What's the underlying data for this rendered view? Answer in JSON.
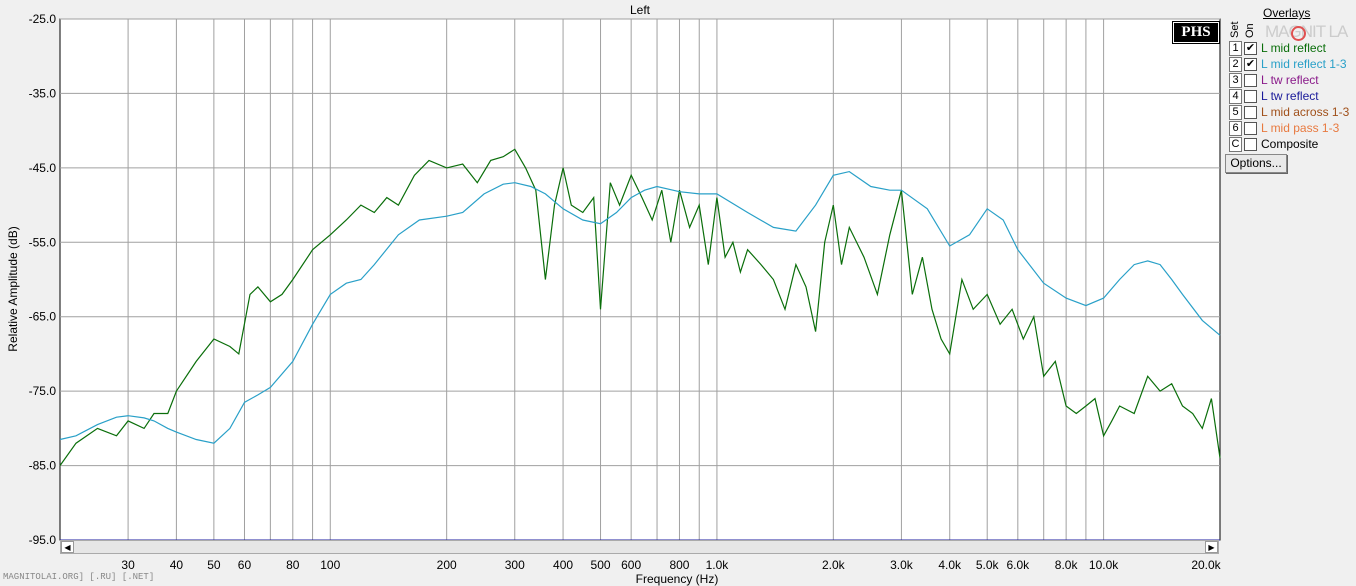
{
  "chart_data": {
    "type": "line",
    "title": "Left",
    "xlabel": "Frequency (Hz)",
    "ylabel": "Relative Amplitude (dB)",
    "xscale": "log",
    "xlim": [
      20,
      20000
    ],
    "ylim": [
      -95,
      -25
    ],
    "grid": true,
    "yticks": [
      "-25.0",
      "-35.0",
      "-45.0",
      "-55.0",
      "-65.0",
      "-75.0",
      "-85.0",
      "-95.0"
    ],
    "xticks": [
      {
        "v": 30,
        "label": "30"
      },
      {
        "v": 40,
        "label": "40"
      },
      {
        "v": 50,
        "label": "50"
      },
      {
        "v": 60,
        "label": "60"
      },
      {
        "v": 80,
        "label": "80"
      },
      {
        "v": 100,
        "label": "100"
      },
      {
        "v": 200,
        "label": "200"
      },
      {
        "v": 300,
        "label": "300"
      },
      {
        "v": 400,
        "label": "400"
      },
      {
        "v": 500,
        "label": "500"
      },
      {
        "v": 600,
        "label": "600"
      },
      {
        "v": 800,
        "label": "800"
      },
      {
        "v": 1000,
        "label": "1.0k"
      },
      {
        "v": 2000,
        "label": "2.0k"
      },
      {
        "v": 3000,
        "label": "3.0k"
      },
      {
        "v": 4000,
        "label": "4.0k"
      },
      {
        "v": 5000,
        "label": "5.0k"
      },
      {
        "v": 6000,
        "label": "6.0k"
      },
      {
        "v": 8000,
        "label": "8.0k"
      },
      {
        "v": 10000,
        "label": "10.0k"
      },
      {
        "v": 20000,
        "label": "20.0k"
      }
    ],
    "series": [
      {
        "name": "L mid reflect",
        "color": "#0a6e0a",
        "x": [
          20,
          22,
          25,
          28,
          30,
          33,
          35,
          38,
          40,
          45,
          50,
          55,
          58,
          62,
          65,
          70,
          75,
          80,
          90,
          100,
          110,
          120,
          130,
          140,
          150,
          165,
          180,
          200,
          220,
          240,
          260,
          280,
          300,
          320,
          340,
          360,
          380,
          400,
          420,
          450,
          480,
          500,
          530,
          560,
          600,
          640,
          680,
          720,
          760,
          800,
          850,
          900,
          950,
          1000,
          1050,
          1100,
          1150,
          1200,
          1300,
          1400,
          1500,
          1600,
          1700,
          1800,
          1900,
          2000,
          2100,
          2200,
          2400,
          2600,
          2800,
          3000,
          3200,
          3400,
          3600,
          3800,
          4000,
          4300,
          4600,
          5000,
          5400,
          5800,
          6200,
          6600,
          7000,
          7500,
          8000,
          8500,
          9000,
          9500,
          10000,
          10500,
          11000,
          12000,
          13000,
          14000,
          15000,
          16000,
          17000,
          18000,
          19000,
          20000
        ],
        "y": [
          -85,
          -82,
          -80,
          -81,
          -79,
          -80,
          -78,
          -78,
          -75,
          -71,
          -68,
          -69,
          -70,
          -62,
          -61,
          -63,
          -62,
          -60,
          -56,
          -54,
          -52,
          -50,
          -51,
          -49,
          -50,
          -46,
          -44,
          -45,
          -44.5,
          -47,
          -44,
          -43.5,
          -42.5,
          -45,
          -48,
          -60,
          -50,
          -45,
          -50,
          -51,
          -49,
          -64,
          -47,
          -50,
          -46,
          -49,
          -52,
          -48,
          -55,
          -48,
          -53,
          -50,
          -58,
          -49,
          -57,
          -55,
          -59,
          -56,
          -58,
          -60,
          -64,
          -58,
          -61,
          -67,
          -55,
          -50,
          -58,
          -53,
          -57,
          -62,
          -54,
          -48,
          -62,
          -57,
          -64,
          -68,
          -70,
          -60,
          -64,
          -62,
          -66,
          -64,
          -68,
          -65,
          -73,
          -71,
          -77,
          -78,
          -77,
          -76,
          -81,
          -79,
          -77,
          -78,
          -73,
          -75,
          -74,
          -77,
          -78,
          -80,
          -76,
          -84
        ]
      },
      {
        "name": "L mid reflect 1-3",
        "color": "#29a0c8",
        "x": [
          20,
          22,
          25,
          28,
          30,
          33,
          35,
          38,
          40,
          45,
          50,
          55,
          60,
          65,
          70,
          80,
          90,
          100,
          110,
          120,
          130,
          150,
          170,
          200,
          220,
          250,
          280,
          300,
          330,
          360,
          400,
          450,
          500,
          550,
          600,
          650,
          700,
          800,
          900,
          1000,
          1200,
          1400,
          1600,
          1800,
          2000,
          2200,
          2500,
          2800,
          3000,
          3500,
          4000,
          4500,
          5000,
          5500,
          6000,
          7000,
          8000,
          9000,
          10000,
          11000,
          12000,
          13000,
          14000,
          15000,
          16000,
          18000,
          20000
        ],
        "y": [
          -81.5,
          -81,
          -79.5,
          -78.5,
          -78.3,
          -78.6,
          -79,
          -80,
          -80.5,
          -81.5,
          -82,
          -80,
          -76.5,
          -75.5,
          -74.5,
          -71,
          -66,
          -62,
          -60.5,
          -60,
          -58,
          -54,
          -52,
          -51.5,
          -51,
          -48.5,
          -47.2,
          -47,
          -47.5,
          -48.5,
          -50.5,
          -52,
          -52.5,
          -51,
          -49,
          -48,
          -47.5,
          -48.2,
          -48.5,
          -48.5,
          -51,
          -53,
          -53.5,
          -50,
          -46,
          -45.5,
          -47.5,
          -48,
          -48,
          -50.5,
          -55.5,
          -54,
          -50.5,
          -52,
          -56,
          -60.5,
          -62.5,
          -63.5,
          -62.5,
          -60,
          -58,
          -57.5,
          -58,
          -60,
          -62,
          -65.5,
          -67.5
        ]
      }
    ]
  },
  "overlays": {
    "title": "Overlays",
    "set_header": "Set",
    "on_header": "On",
    "items": [
      {
        "set": "1",
        "on": true,
        "checkmark": "✔",
        "label": "L mid reflect",
        "color": "#0a6e0a"
      },
      {
        "set": "2",
        "on": true,
        "checkmark": "✔",
        "label": "L mid reflect 1-3",
        "color": "#29a0c8"
      },
      {
        "set": "3",
        "on": false,
        "checkmark": "",
        "label": "L tw reflect",
        "color": "#8a1a8a"
      },
      {
        "set": "4",
        "on": false,
        "checkmark": "",
        "label": "L tw reflect",
        "color": "#1a1a9a"
      },
      {
        "set": "5",
        "on": false,
        "checkmark": "",
        "label": "L mid across 1-3",
        "color": "#a0501a"
      },
      {
        "set": "6",
        "on": false,
        "checkmark": "",
        "label": "L mid pass 1-3",
        "color": "#e87a40"
      },
      {
        "set": "C",
        "on": false,
        "checkmark": "",
        "label": "Composite",
        "color": "#000000"
      }
    ],
    "options_label": "Options...",
    "logo_text": "MAGNIT LA"
  },
  "badge": "PHS",
  "watermark": "MAGNITOLAI.ORG] [.RU] [.NET]",
  "scroll": {
    "left_arrow": "◀",
    "right_arrow": "▶"
  }
}
